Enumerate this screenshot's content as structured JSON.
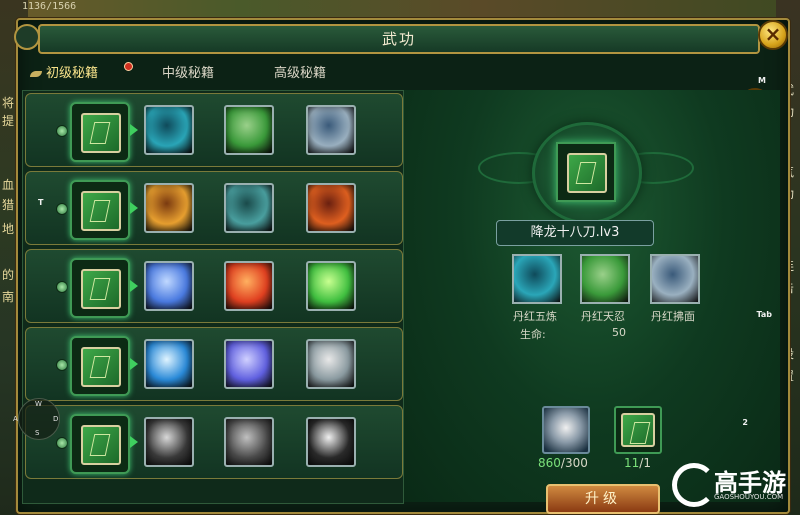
{
  "hud": {
    "hp_text": "1136/1566",
    "left_edge_text": [
      "将",
      "提",
      "血",
      "猎",
      "地",
      "的",
      "南"
    ],
    "right_edge_text": [
      "武",
      "功",
      "气",
      "功",
      "连",
      "击",
      "设",
      "置"
    ]
  },
  "window": {
    "title": "武功",
    "close_label": "×"
  },
  "tabs": [
    {
      "label": "初级秘籍",
      "active": true
    },
    {
      "label": "中级秘籍",
      "active": false
    },
    {
      "label": "高级秘籍",
      "active": false
    }
  ],
  "help_label": "?",
  "key_hints": {
    "m": "M",
    "t": "T",
    "tab": "Tab",
    "num2": "2"
  },
  "compass": {
    "w": "W",
    "a": "A",
    "s": "S",
    "d": "D"
  },
  "rows": [
    {
      "book_icon": "green-book-icon",
      "skills": [
        "stone-fist-icon",
        "blade-slash-icon",
        "wind-sword-icon"
      ],
      "colors": [
        [
          "#2aa6b8",
          "#0f4a5a"
        ],
        [
          "#3a9a3a",
          "#9ad08a"
        ],
        [
          "#9ab0c0",
          "#3a5a7a"
        ]
      ]
    },
    {
      "book_icon": "green-book-icon",
      "skills": [
        "golden-armor-icon",
        "claw-icon",
        "flame-vortex-icon"
      ],
      "colors": [
        [
          "#e8a030",
          "#7a3a10"
        ],
        [
          "#4aa0a0",
          "#1a4a4a"
        ],
        [
          "#e06020",
          "#6a2010"
        ]
      ]
    },
    {
      "book_icon": "green-book-icon",
      "skills": [
        "lightning-burst-icon",
        "fire-strike-icon",
        "dragon-coil-icon"
      ],
      "colors": [
        [
          "#4a7ae0",
          "#c0d8ff"
        ],
        [
          "#e04020",
          "#ffb060"
        ],
        [
          "#40c040",
          "#c8ff90"
        ]
      ]
    },
    {
      "book_icon": "green-book-icon",
      "skills": [
        "blue-crescent-icon",
        "arcane-orbit-icon",
        "silver-flow-icon"
      ],
      "colors": [
        [
          "#2a8ad8",
          "#e0f4ff"
        ],
        [
          "#6060e0",
          "#d0d0ff"
        ],
        [
          "#8a9aa0",
          "#e8e8e8"
        ]
      ]
    },
    {
      "book_icon": "green-book-icon",
      "skills": [
        "chain-icon",
        "dark-blade-icon",
        "shatter-icon"
      ],
      "colors": [
        [
          "#3a3a3a",
          "#d8d8d8"
        ],
        [
          "#4a4a4a",
          "#c0c0c0"
        ],
        [
          "#2a2a2a",
          "#f0f0f0"
        ]
      ]
    }
  ],
  "detail": {
    "skill_name": "降龙十八刀.lv3",
    "sub_skills": [
      {
        "label": "丹红五炼",
        "icon": "stone-fist-icon"
      },
      {
        "label": "丹红天忍",
        "icon": "blade-slash-icon"
      },
      {
        "label": "丹红拂面",
        "icon": "wind-sword-icon"
      }
    ],
    "stat_label": "生命:",
    "stat_value": "50",
    "costs": [
      {
        "icon": "silver-ore-icon",
        "current": "860",
        "required": "/300"
      },
      {
        "icon": "green-book-icon",
        "current": "11",
        "required": "/1"
      }
    ],
    "upgrade_label": "升级"
  },
  "watermark": {
    "text": "高手游",
    "url": "GAOSHOUYOU.COM"
  },
  "colors": {
    "frame_gold": "#b29540",
    "panel_green": "#0f3a20",
    "active_tab": "#f7e28a",
    "resource_ok": "#7ae07a"
  }
}
